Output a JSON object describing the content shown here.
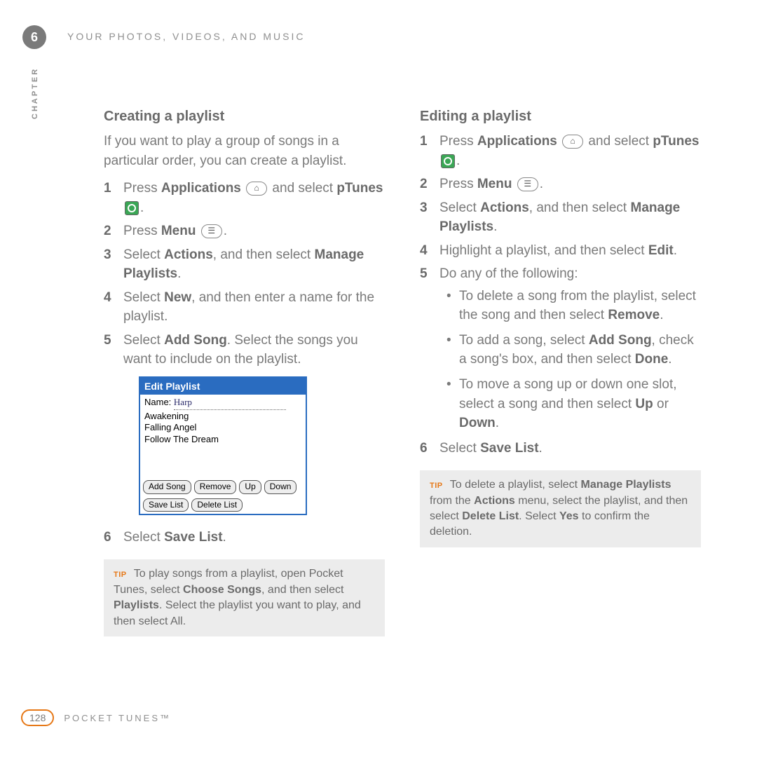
{
  "chapter_number": "6",
  "header_title": "YOUR PHOTOS, VIDEOS, AND MUSIC",
  "vertical_label": "CHAPTER",
  "left": {
    "heading": "Creating a playlist",
    "intro": "If you want to play a group of songs in a particular order, you can create a playlist.",
    "steps": {
      "s1_a": "Press ",
      "s1_b": "Applications",
      "s1_c": " and select ",
      "s1_d": "pTunes",
      "s1_e": ".",
      "s2_a": "Press ",
      "s2_b": "Menu",
      "s2_c": ".",
      "s3_a": "Select ",
      "s3_b": "Actions",
      "s3_c": ", and then select ",
      "s3_d": "Manage Playlists",
      "s3_e": ".",
      "s4_a": "Select ",
      "s4_b": "New",
      "s4_c": ", and then enter a name for the playlist.",
      "s5_a": "Select ",
      "s5_b": "Add Song",
      "s5_c": ". Select the songs you want to include on the playlist.",
      "s6_a": "Select ",
      "s6_b": "Save List",
      "s6_c": "."
    },
    "shot": {
      "title": "Edit Playlist",
      "name_label": "Name: ",
      "name_value": "Harp",
      "rows": [
        "Awakening",
        "Falling Angel",
        "Follow The Dream"
      ],
      "buttons": [
        "Add Song",
        "Remove",
        "Up",
        "Down",
        "Save List",
        "Delete List"
      ]
    },
    "tip": {
      "tag": "TIP",
      "a": " To play songs from a playlist, open Pocket Tunes, select ",
      "b": "Choose Songs",
      "c": ", and then select ",
      "d": "Playlists",
      "e": ". Select the playlist you want to play, and then select All."
    }
  },
  "right": {
    "heading": "Editing a playlist",
    "steps": {
      "s1_a": "Press ",
      "s1_b": "Applications",
      "s1_c": " and select ",
      "s1_d": "pTunes",
      "s1_e": ".",
      "s2_a": "Press ",
      "s2_b": "Menu",
      "s2_c": ".",
      "s3_a": "Select ",
      "s3_b": "Actions",
      "s3_c": ", and then select ",
      "s3_d": "Manage Playlists",
      "s3_e": ".",
      "s4_a": "Highlight a playlist, and then select ",
      "s4_b": "Edit",
      "s4_c": ".",
      "s5_a": "Do any of the following:",
      "b1_a": "To delete a song from the playlist, select the song and then select ",
      "b1_b": "Remove",
      "b1_c": ".",
      "b2_a": "To add a song, select ",
      "b2_b": "Add Song",
      "b2_c": ", check a song's box, and then select ",
      "b2_d": "Done",
      "b2_e": ".",
      "b3_a": "To move a song up or down one slot, select a song and then select ",
      "b3_b": "Up",
      "b3_c": " or ",
      "b3_d": "Down",
      "b3_e": ".",
      "s6_a": "Select ",
      "s6_b": "Save List",
      "s6_c": "."
    },
    "tip": {
      "tag": "TIP",
      "a": " To delete a playlist, select ",
      "b": "Manage Playlists",
      "c": " from the ",
      "d": "Actions",
      "e": " menu, select the playlist, and then select ",
      "f": "Delete List",
      "g": ". Select ",
      "h": "Yes",
      "i": " to confirm the deletion."
    }
  },
  "footer": {
    "page": "128",
    "title": "POCKET TUNES™"
  },
  "icons": {
    "home": "⌂",
    "menu": "☰"
  }
}
